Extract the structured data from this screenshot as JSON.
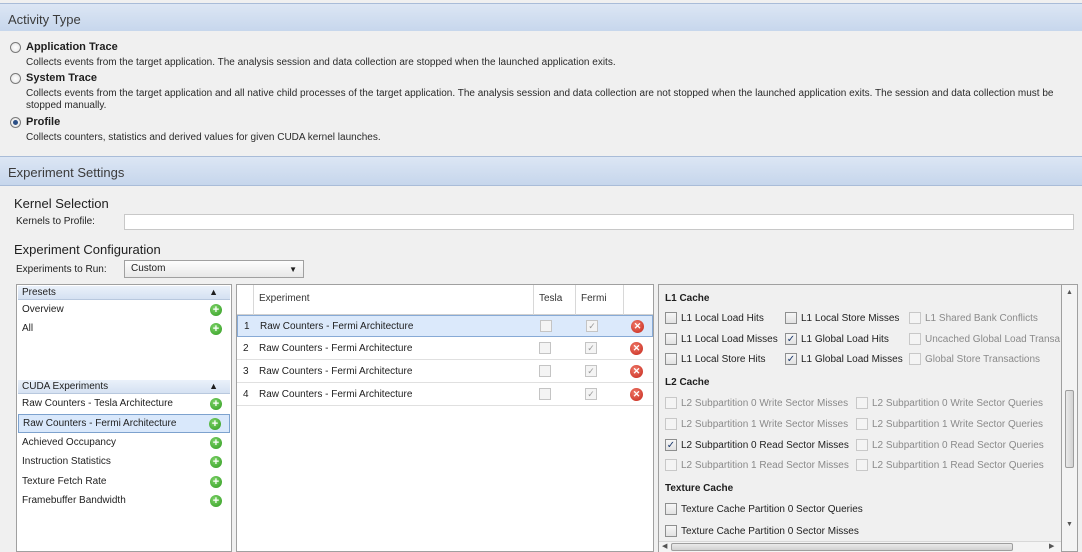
{
  "activity": {
    "header": "Activity Type",
    "options": [
      {
        "label": "Application Trace",
        "checked": false,
        "description": "Collects events from the target application.  The analysis session and data collection are stopped when the launched application exits."
      },
      {
        "label": "System Trace",
        "checked": false,
        "description": "Collects events from the target application and all native child processes of the target application.  The analysis session and data collection are not stopped when the launched application exits.  The session and data collection must be stopped manually."
      },
      {
        "label": "Profile",
        "checked": true,
        "description": "Collects counters, statistics and derived values for given CUDA kernel launches."
      }
    ]
  },
  "experiment": {
    "header": "Experiment Settings",
    "kernel_selection_title": "Kernel Selection",
    "kernels_label": "Kernels to Profile:",
    "kernels_value": "",
    "config_title": "Experiment Configuration",
    "run_label": "Experiments to Run:",
    "run_value": "Custom"
  },
  "presets": {
    "header": "Presets",
    "items": [
      "Overview",
      "All"
    ],
    "cuda_header": "CUDA Experiments",
    "cuda_items": [
      "Raw Counters - Tesla Architecture",
      "Raw Counters - Fermi Architecture",
      "Achieved Occupancy",
      "Instruction Statistics",
      "Texture Fetch Rate",
      "Framebuffer Bandwidth"
    ],
    "selected_cuda": "Raw Counters - Fermi Architecture"
  },
  "grid": {
    "columns": [
      "Experiment",
      "Tesla",
      "Fermi"
    ],
    "rows": [
      {
        "num": "1",
        "name": "Raw Counters - Fermi Architecture",
        "tesla": false,
        "fermi": true
      },
      {
        "num": "2",
        "name": "Raw Counters - Fermi Architecture",
        "tesla": false,
        "fermi": true
      },
      {
        "num": "3",
        "name": "Raw Counters - Fermi Architecture",
        "tesla": false,
        "fermi": true
      },
      {
        "num": "4",
        "name": "Raw Counters - Fermi Architecture",
        "tesla": false,
        "fermi": true
      }
    ]
  },
  "counters": {
    "l1_title": "L1 Cache",
    "l1": [
      {
        "label": "L1 Local Load Hits",
        "checked": false,
        "enabled": true
      },
      {
        "label": "L1 Local Store Misses",
        "checked": false,
        "enabled": true
      },
      {
        "label": "L1 Shared Bank Conflicts",
        "checked": false,
        "enabled": false
      },
      {
        "label": "L1 Local Load Misses",
        "checked": false,
        "enabled": true
      },
      {
        "label": "L1 Global Load Hits",
        "checked": true,
        "enabled": true
      },
      {
        "label": "Uncached Global Load Transa",
        "checked": false,
        "enabled": false
      },
      {
        "label": "L1 Local Store Hits",
        "checked": false,
        "enabled": true
      },
      {
        "label": "L1 Global Load Misses",
        "checked": true,
        "enabled": true
      },
      {
        "label": "Global Store Transactions",
        "checked": false,
        "enabled": false
      }
    ],
    "l2_title": "L2 Cache",
    "l2": [
      {
        "label": "L2 Subpartition 0 Write Sector Misses",
        "checked": false,
        "enabled": false
      },
      {
        "label": "L2 Subpartition 0 Write Sector Queries",
        "checked": false,
        "enabled": false
      },
      {
        "label": "L2 Subpartition 1 Write Sector Misses",
        "checked": false,
        "enabled": false
      },
      {
        "label": "L2 Subpartition 1 Write Sector Queries",
        "checked": false,
        "enabled": false
      },
      {
        "label": "L2 Subpartition 0 Read Sector Misses",
        "checked": true,
        "enabled": true
      },
      {
        "label": "L2 Subpartition 0 Read Sector Queries",
        "checked": false,
        "enabled": false
      },
      {
        "label": "L2 Subpartition 1 Read Sector Misses",
        "checked": false,
        "enabled": false
      },
      {
        "label": "L2 Subpartition 1 Read Sector Queries",
        "checked": false,
        "enabled": false
      }
    ],
    "tex_title": "Texture Cache",
    "tex": [
      {
        "label": "Texture Cache Partition 0 Sector Queries",
        "checked": false,
        "enabled": true
      },
      {
        "label": "Texture Cache Partition 0 Sector Misses",
        "checked": false,
        "enabled": true
      }
    ]
  },
  "icons": {
    "add": "plus-circle-icon",
    "delete": "close-circle-icon"
  }
}
